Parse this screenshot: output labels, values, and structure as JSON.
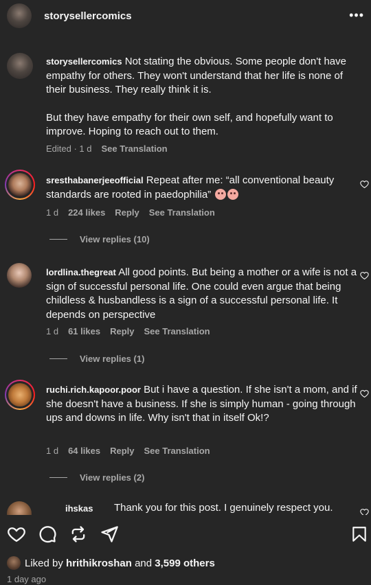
{
  "header": {
    "username": "storysellercomics",
    "more_icon": "more-horizontal-icon"
  },
  "caption": {
    "user": "storysellercomics",
    "text_p1": "Not stating the obvious. Some people don't have empathy for others. They won't understand that her life is none of their business. They really think it is.",
    "text_p2": "But they have empathy for their own self, and hopefully want to improve. Hoping to reach out to them.",
    "meta_time": "Edited · 1 d",
    "see_translation": "See Translation"
  },
  "comments": [
    {
      "user": "sresthabanerjeeofficial",
      "text": "Repeat after me: “all conventional beauty standards are rooted in paedophilia”",
      "time": "1 d",
      "likes": "224 likes",
      "reply": "Reply",
      "see_translation": "See Translation",
      "view_replies": "View replies (10)"
    },
    {
      "user": "lordlina.thegreat",
      "text": "All good points. But being a mother or a wife is not a sign of successful personal life. One could even argue that being childless & husbandless is a sign of a successful personal life. It depends on perspective",
      "time": "1 d",
      "likes": "61 likes",
      "reply": "Reply",
      "see_translation": "See Translation",
      "view_replies": "View replies (1)"
    },
    {
      "user": "ruchi.rich.kapoor.poor",
      "text": "But i have a question. If she isn't a mom, and if she doesn't have a business. If she is simply human - going through ups and downs in life. Why isn't that in itself Ok!?",
      "time": "1 d",
      "likes": "64 likes",
      "reply": "Reply",
      "see_translation": "See Translation",
      "view_replies": "View replies (2)"
    },
    {
      "user": "ihskas",
      "text": "Thank you for this post. I genuinely respect you."
    }
  ],
  "actions": {
    "like_icon": "heart-icon",
    "comment_icon": "comment-icon",
    "share_icon": "repost-icon",
    "send_icon": "send-icon",
    "save_icon": "bookmark-icon"
  },
  "likes_summary": {
    "prefix": "Liked by",
    "user": "hrithikroshan",
    "joiner": "and",
    "others": "3,599 others"
  },
  "time_ago": "1 day ago",
  "colors": {
    "background": "#262626",
    "text": "#f5f5f5",
    "muted": "#a8a8a8"
  }
}
